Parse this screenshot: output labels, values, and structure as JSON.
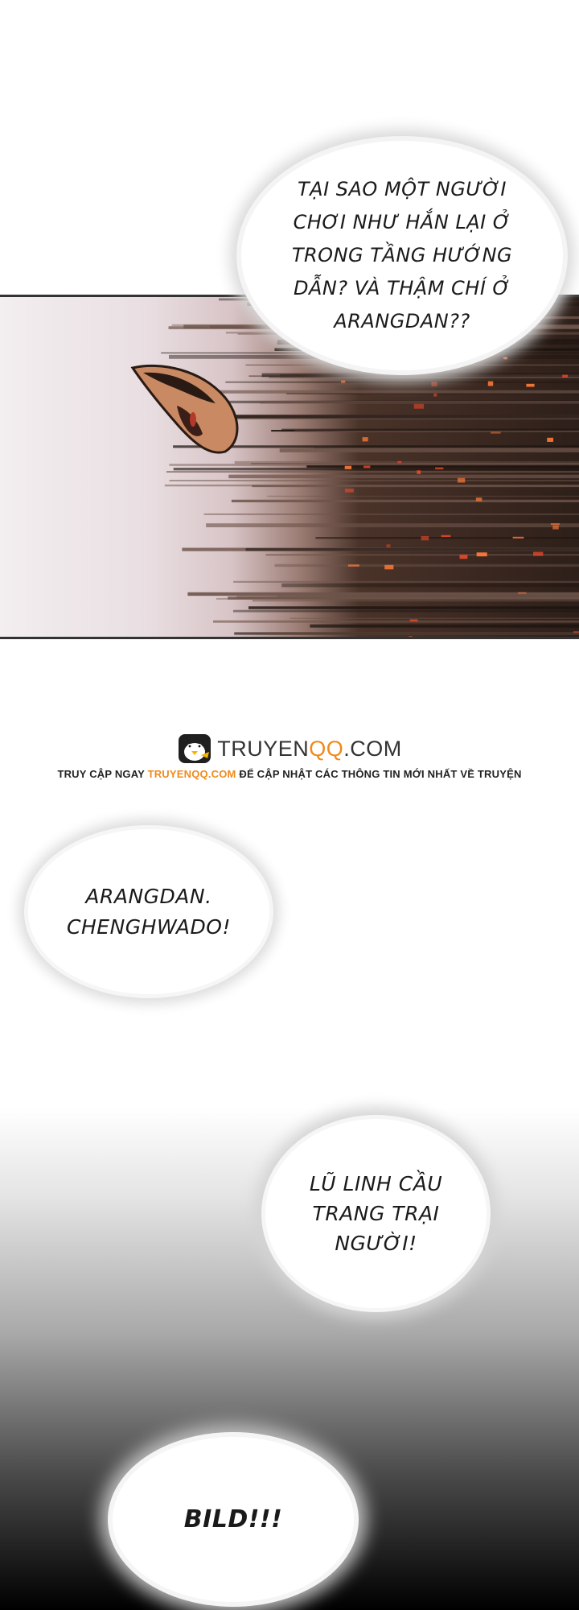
{
  "watermark": {
    "brand_main": "TRUYEN",
    "brand_accent": "QQ",
    "brand_suffix": ".COM",
    "tagline_prefix": "TRUY CẬP NGAY",
    "tagline_link": "TRUYENQQ.COM",
    "tagline_suffix": "ĐỂ CẬP NHẬT CÁC THÔNG TIN MỚI NHẤT VỀ TRUYỆN",
    "accent_color": "#f08a1c"
  },
  "bubbles": [
    {
      "lines": [
        "TẠI SAO MỘT NGƯỜI",
        "CHƠI NHƯ HẮN LẠI Ở",
        "TRONG TẦNG HƯỚNG",
        "DẪN? VÀ THẬM CHÍ Ở",
        "ARANGDAN??"
      ]
    },
    {
      "lines": [
        "ARANGDAN.",
        "CHENGHWADO!"
      ]
    },
    {
      "lines": [
        "LŨ LINH CẦU",
        "TRANG TRẠI",
        "NGƯỜI!"
      ]
    },
    {
      "lines": [
        "BILD!!!"
      ]
    }
  ],
  "icons": {
    "logo": "penguin-mascot-icon"
  }
}
